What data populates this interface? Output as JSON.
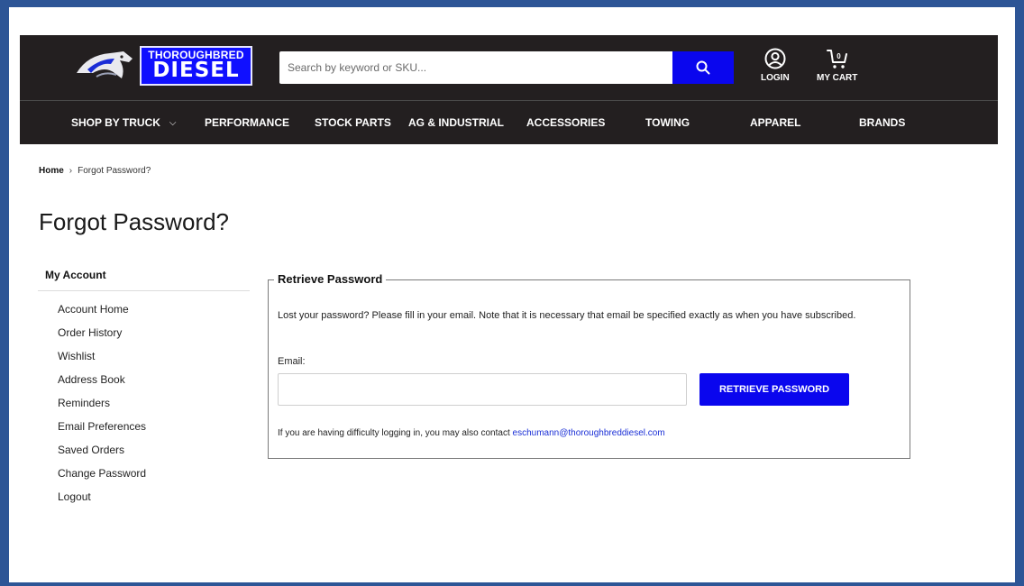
{
  "header": {
    "brand_top": "THOROUGHBRED",
    "brand_bottom": "DIESEL",
    "search_placeholder": "Search by keyword or SKU...",
    "login_label": "LOGIN",
    "cart_label": "MY CART",
    "cart_count": "0"
  },
  "nav": {
    "items": [
      {
        "label": "SHOP BY TRUCK",
        "dropdown": true
      },
      {
        "label": "PERFORMANCE"
      },
      {
        "label": "STOCK PARTS"
      },
      {
        "label": "AG & INDUSTRIAL"
      },
      {
        "label": "ACCESSORIES"
      },
      {
        "label": "TOWING"
      },
      {
        "label": "APPAREL"
      },
      {
        "label": "BRANDS"
      }
    ],
    "dropdown_glyph": "⌵"
  },
  "breadcrumb": {
    "home": "Home",
    "separator": "›",
    "current": "Forgot Password?"
  },
  "page_title": "Forgot Password?",
  "sidebar": {
    "heading": "My Account",
    "items": [
      "Account Home",
      "Order History",
      "Wishlist",
      "Address Book",
      "Reminders",
      "Email Preferences",
      "Saved Orders",
      "Change Password",
      "Logout"
    ]
  },
  "retrieve": {
    "legend": "Retrieve Password",
    "description": "Lost your password? Please fill in your email. Note that it is necessary that email be specified exactly as when you have subscribed.",
    "email_label": "Email:",
    "email_value": "",
    "button_label": "RETRIEVE PASSWORD",
    "help_text": "If you are having difficulty logging in, you may also contact ",
    "help_email": "eschumann@thoroughbreddiesel.com"
  },
  "colors": {
    "accent_blue": "#0a06ee",
    "header_bg": "#231f20",
    "outer_border": "#2d5596"
  }
}
